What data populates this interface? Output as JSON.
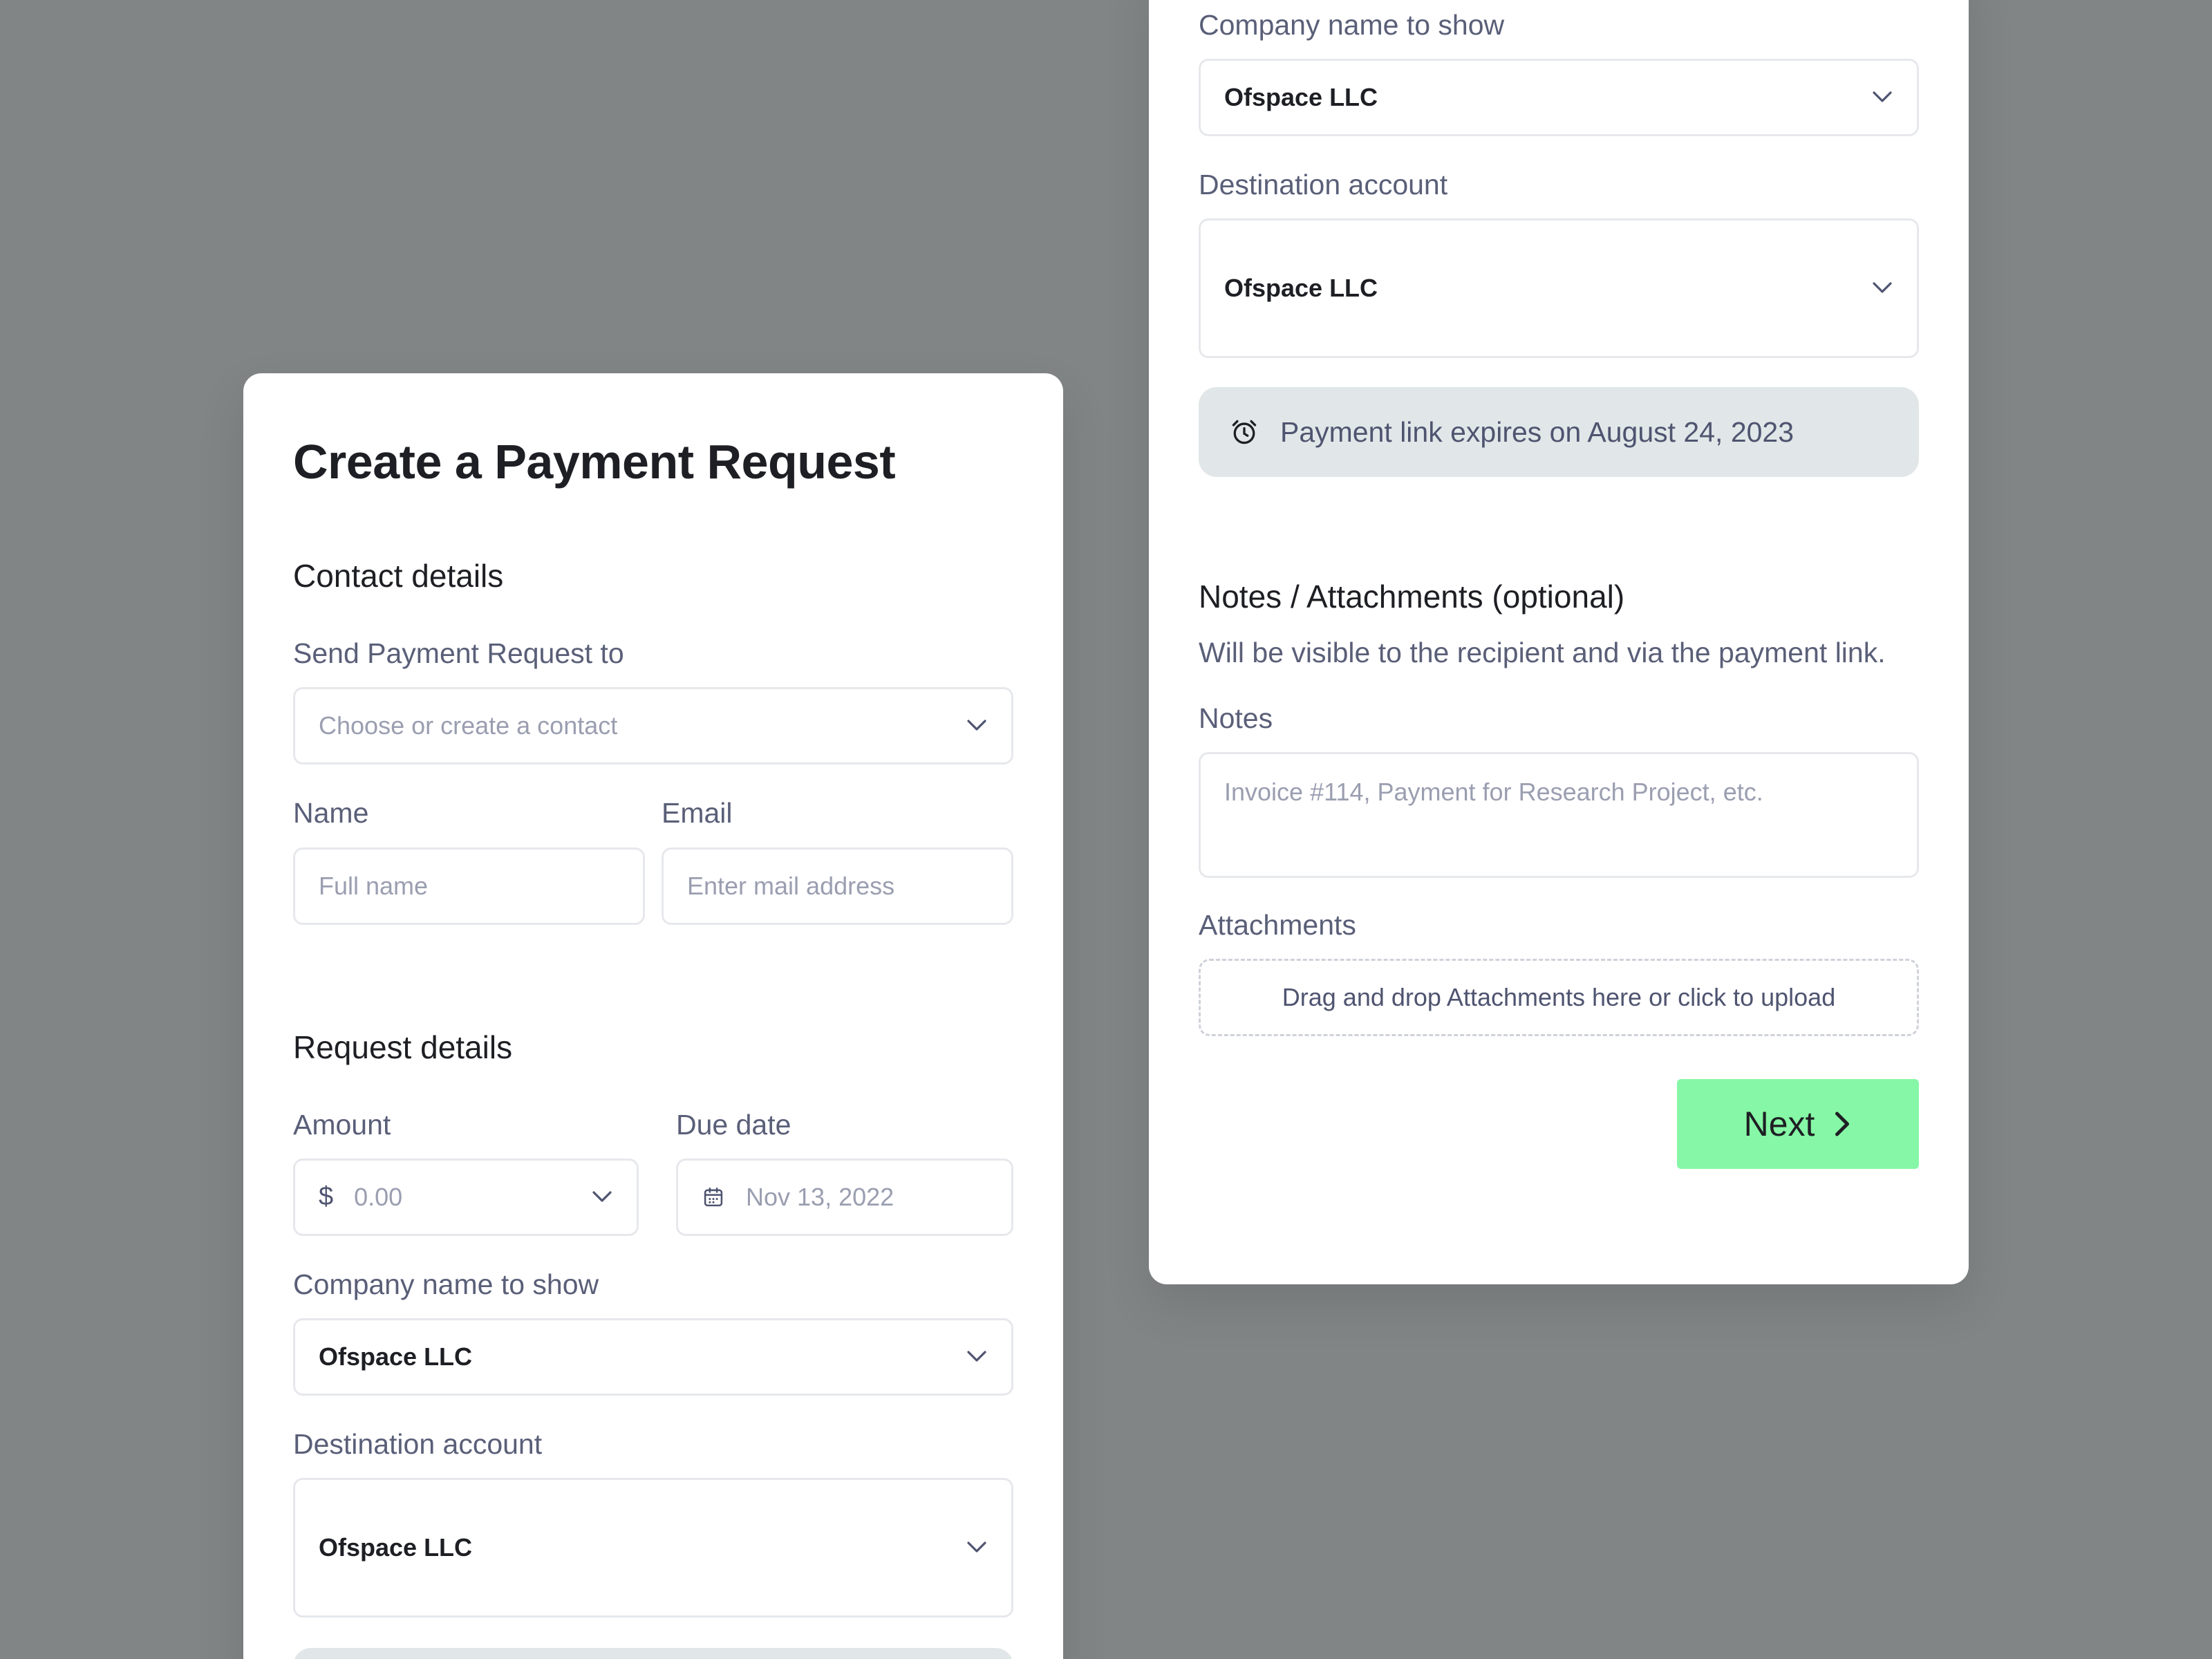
{
  "left": {
    "title": "Create a Payment Request",
    "contact_section": "Contact details",
    "send_to_label": "Send Payment Request to",
    "send_to_placeholder": "Choose or create a contact",
    "name_label": "Name",
    "name_placeholder": "Full name",
    "email_label": "Email",
    "email_placeholder": "Enter mail address",
    "request_section": "Request details",
    "amount_label": "Amount",
    "amount_prefix": "$",
    "amount_placeholder": "0.00",
    "due_label": "Due date",
    "due_placeholder": "Nov 13, 2022",
    "company_label": "Company name to show",
    "company_value": "Ofspace LLC",
    "destination_label": "Destination account",
    "destination_value": "Ofspace LLC"
  },
  "right": {
    "company_label": "Company name to show",
    "company_value": "Ofspace LLC",
    "destination_label": "Destination account",
    "destination_value": "Ofspace LLC",
    "expiry_text": "Payment link expires on August 24, 2023",
    "notes_section": "Notes / Attachments (optional)",
    "notes_help": "Will be visible to the recipient and via the payment link.",
    "notes_label": "Notes",
    "notes_placeholder": "Invoice #114, Payment for Research Project, etc.",
    "attachments_label": "Attachments",
    "attachments_drop": "Drag and drop Attachments here or click to upload",
    "next_label": "Next"
  },
  "colors": {
    "background": "#818585",
    "card": "#ffffff",
    "accent_button": "#86f7a6",
    "banner": "#e1e7e8"
  }
}
